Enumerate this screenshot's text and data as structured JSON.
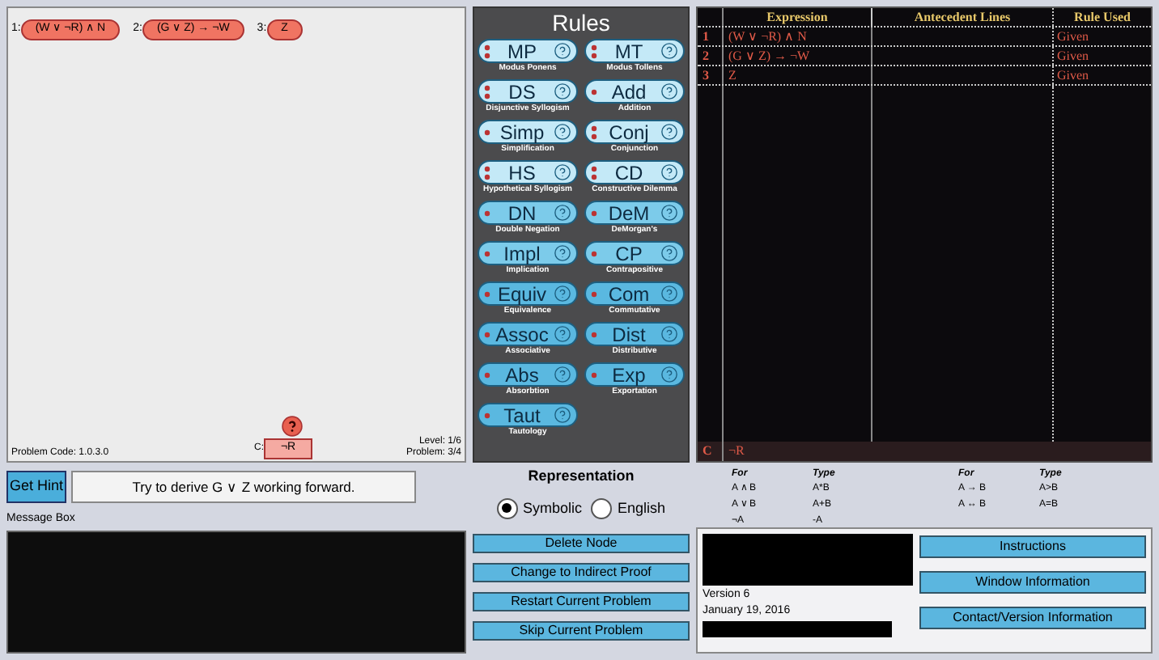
{
  "canvas": {
    "premises": [
      {
        "number": "1:",
        "expression": "(W ∨ ¬R) ∧ N"
      },
      {
        "number": "2:",
        "expression": "(G ∨ Z) → ¬W"
      },
      {
        "number": "3:",
        "expression": "Z"
      }
    ],
    "goal": {
      "label": "C:",
      "expression": "¬R"
    },
    "problem_code": "Problem Code: 1.0.3.0",
    "level": "Level: 1/6",
    "problem": "Problem: 3/4"
  },
  "hint": {
    "button": "Get Hint",
    "text": "Try to derive G ∨ Z working forward."
  },
  "message_box": {
    "label": "Message Box"
  },
  "rules": {
    "title": "Rules",
    "items": [
      {
        "abbr": "MP",
        "name": "Modus Ponens",
        "kind": "double",
        "color": "#c4e9f7"
      },
      {
        "abbr": "MT",
        "name": "Modus Tollens",
        "kind": "double",
        "color": "#c4e9f7"
      },
      {
        "abbr": "DS",
        "name": "Disjunctive Syllogism",
        "kind": "double",
        "color": "#c4e9f7"
      },
      {
        "abbr": "Add",
        "name": "Addition",
        "kind": "single",
        "color": "#c4e9f7"
      },
      {
        "abbr": "Simp",
        "name": "Simplification",
        "kind": "single",
        "color": "#c4e9f7"
      },
      {
        "abbr": "Conj",
        "name": "Conjunction",
        "kind": "double",
        "color": "#c4e9f7"
      },
      {
        "abbr": "HS",
        "name": "Hypothetical Syllogism",
        "kind": "double",
        "color": "#c4e9f7"
      },
      {
        "abbr": "CD",
        "name": "Constructive Dilemma",
        "kind": "double",
        "color": "#c4e9f7"
      },
      {
        "abbr": "DN",
        "name": "Double Negation",
        "kind": "single",
        "color": "#7ccbea"
      },
      {
        "abbr": "DeM",
        "name": "DeMorgan's",
        "kind": "single",
        "color": "#7ccbea"
      },
      {
        "abbr": "Impl",
        "name": "Implication",
        "kind": "single",
        "color": "#7ccbea"
      },
      {
        "abbr": "CP",
        "name": "Contrapositive",
        "kind": "single",
        "color": "#7ccbea"
      },
      {
        "abbr": "Equiv",
        "name": "Equivalence",
        "kind": "single",
        "color": "#5ab8e0"
      },
      {
        "abbr": "Com",
        "name": "Commutative",
        "kind": "single",
        "color": "#5ab8e0"
      },
      {
        "abbr": "Assoc",
        "name": "Associative",
        "kind": "single",
        "color": "#5ab8e0"
      },
      {
        "abbr": "Dist",
        "name": "Distributive",
        "kind": "single",
        "color": "#5ab8e0"
      },
      {
        "abbr": "Abs",
        "name": "Absorbtion",
        "kind": "single",
        "color": "#5ab8e0"
      },
      {
        "abbr": "Exp",
        "name": "Exportation",
        "kind": "single",
        "color": "#5ab8e0"
      },
      {
        "abbr": "Taut",
        "name": "Tautology",
        "kind": "single",
        "color": "#5ab8e0"
      }
    ]
  },
  "representation": {
    "title": "Representation",
    "options": [
      {
        "label": "Symbolic",
        "selected": true
      },
      {
        "label": "English",
        "selected": false
      }
    ]
  },
  "actions": [
    "Delete Node",
    "Change to Indirect Proof",
    "Restart Current Problem",
    "Skip Current Problem"
  ],
  "table": {
    "columns": [
      "Expression",
      "Antecedent Lines",
      "Rule Used"
    ],
    "rows": [
      {
        "number": "1",
        "expression": "(W ∨ ¬R) ∧ N",
        "rule": "Given"
      },
      {
        "number": "2",
        "expression": "(G ∨ Z) → ¬W",
        "rule": "Given"
      },
      {
        "number": "3",
        "expression": "Z",
        "rule": "Given"
      }
    ],
    "conclusion": {
      "label": "C",
      "expression": "¬R"
    }
  },
  "legend": [
    {
      "headers": [
        "For",
        "Type"
      ],
      "rows": [
        [
          "A ∧ B",
          "A*B"
        ],
        [
          "A ∨ B",
          "A+B"
        ],
        [
          "¬A",
          "-A"
        ]
      ]
    },
    {
      "headers": [
        "For",
        "Type"
      ],
      "rows": [
        [
          "A → B",
          "A>B"
        ],
        [
          "A ↔ B",
          "A=B"
        ]
      ]
    }
  ],
  "info": {
    "version": "Version 6",
    "date": "January 19, 2016",
    "buttons": [
      "Instructions",
      "Window Information",
      "Contact/Version Information"
    ]
  }
}
